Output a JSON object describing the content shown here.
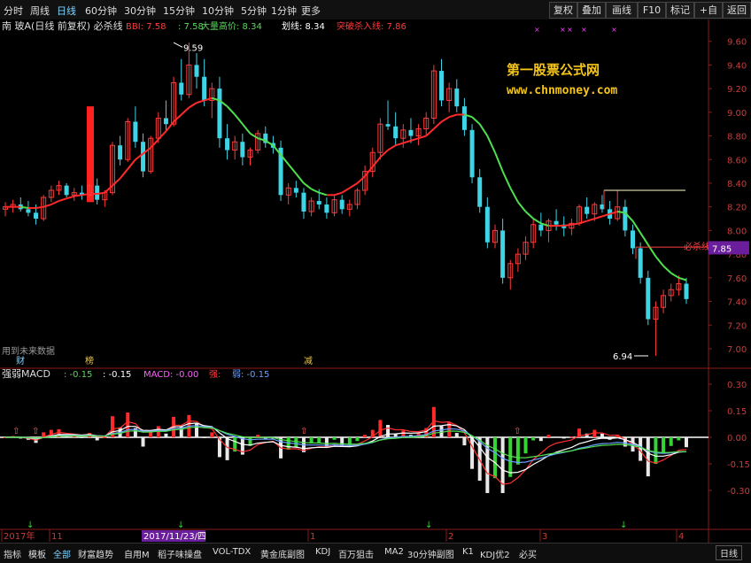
{
  "toolbar": {
    "left": [
      "分时",
      "周线",
      "日线",
      "60分钟",
      "30分钟",
      "15分钟",
      "10分钟",
      "5分钟",
      "1分钟",
      "更多"
    ],
    "right": [
      "复权",
      "叠加",
      "画线",
      "F10",
      "标记",
      "+自选",
      "返回"
    ]
  },
  "main": {
    "title": "南 玻A(日线 前复权) 必杀线",
    "legend": [
      {
        "label": "BBI: 7.58",
        "color": "#ff3b3b"
      },
      {
        "label": ": 7.58",
        "color": "#5cd65c"
      },
      {
        "label": "大量高价: 8.34",
        "color": "#5cd65c"
      },
      {
        "label": "划线: 8.34",
        "color": "#ffffff"
      },
      {
        "label": "突破杀入线: 7.86",
        "color": "#ff3b3b"
      }
    ],
    "watermark1": "第一股票公式网",
    "watermark2": "www.chnmoney.com",
    "yticks": [
      "9.60",
      "9.40",
      "9.20",
      "9.00",
      "8.80",
      "8.60",
      "8.40",
      "8.20",
      "8.00",
      "7.80",
      "7.60",
      "7.40",
      "7.20",
      "7.00"
    ],
    "current_price": "7.85",
    "high_label": "9.59",
    "low_label": "6.94",
    "kill_label": "必杀线",
    "future_note": "用到未来数据",
    "markers": [
      {
        "text": "财",
        "color": "#7fd4ff"
      },
      {
        "text": "榜",
        "color": "#e6c34a"
      },
      {
        "text": "减",
        "color": "#e6c34a"
      }
    ]
  },
  "sub": {
    "title": "强弱MACD",
    "legend": [
      {
        "label": ": -0.15",
        "color": "#5cd65c"
      },
      {
        "label": ": -0.15",
        "color": "#ffffff"
      },
      {
        "label": "MACD: -0.00",
        "color": "#ff60ff"
      },
      {
        "label": "强:",
        "color": "#ff3b3b"
      },
      {
        "label": "弱: -0.15",
        "color": "#6aa0ff"
      }
    ],
    "yticks": [
      "0.30",
      "0.15",
      "0.00",
      "-0.15",
      "-0.30"
    ]
  },
  "xaxis": {
    "labels": [
      "2017年",
      "11",
      "2017/11/23/四",
      "1",
      "2",
      "3",
      "4"
    ]
  },
  "bottom_tabs": [
    "指标",
    "模板",
    "全部",
    "财富趋势",
    "自用M",
    "稻子味操盘",
    "VOL-TDX",
    "黄金底副图",
    "KDJ",
    "百万狙击",
    "MA2",
    "30分钟副图",
    "K1",
    "KDJ优2",
    "必买"
  ],
  "bottom_right": "日线",
  "chart_data": {
    "type": "candlestick",
    "title": "南 玻A(日线 前复权) 必杀线",
    "ylim": [
      6.85,
      9.65
    ],
    "ohlc": [
      [
        8.18,
        8.24,
        8.12,
        8.2
      ],
      [
        8.2,
        8.26,
        8.15,
        8.22
      ],
      [
        8.22,
        8.28,
        8.16,
        8.18
      ],
      [
        8.18,
        8.25,
        8.12,
        8.15
      ],
      [
        8.15,
        8.22,
        8.05,
        8.1
      ],
      [
        8.1,
        8.3,
        8.08,
        8.28
      ],
      [
        8.28,
        8.38,
        8.24,
        8.34
      ],
      [
        8.34,
        8.42,
        8.3,
        8.38
      ],
      [
        8.38,
        8.4,
        8.28,
        8.3
      ],
      [
        8.3,
        8.36,
        8.25,
        8.32
      ],
      [
        8.32,
        8.38,
        8.26,
        8.3
      ],
      [
        8.3,
        8.4,
        8.28,
        8.38
      ],
      [
        8.38,
        8.44,
        8.22,
        8.26
      ],
      [
        8.26,
        8.34,
        8.2,
        8.32
      ],
      [
        8.32,
        8.75,
        8.3,
        8.72
      ],
      [
        8.72,
        8.8,
        8.55,
        8.6
      ],
      [
        8.6,
        8.95,
        8.58,
        8.92
      ],
      [
        8.92,
        9.05,
        8.7,
        8.75
      ],
      [
        8.75,
        8.82,
        8.45,
        8.5
      ],
      [
        8.5,
        8.8,
        8.48,
        8.78
      ],
      [
        8.78,
        9.0,
        8.74,
        8.95
      ],
      [
        8.95,
        9.1,
        8.85,
        8.9
      ],
      [
        8.9,
        9.3,
        8.88,
        9.25
      ],
      [
        9.25,
        9.45,
        9.1,
        9.15
      ],
      [
        9.15,
        9.59,
        9.12,
        9.4
      ],
      [
        9.4,
        9.5,
        9.2,
        9.3
      ],
      [
        9.3,
        9.45,
        9.05,
        9.1
      ],
      [
        9.1,
        9.25,
        8.95,
        9.2
      ],
      [
        9.2,
        9.3,
        8.7,
        8.78
      ],
      [
        8.78,
        8.9,
        8.6,
        8.68
      ],
      [
        8.68,
        8.8,
        8.6,
        8.75
      ],
      [
        8.75,
        8.82,
        8.55,
        8.62
      ],
      [
        8.62,
        8.7,
        8.55,
        8.68
      ],
      [
        8.68,
        8.85,
        8.65,
        8.82
      ],
      [
        8.82,
        8.88,
        8.7,
        8.74
      ],
      [
        8.74,
        8.8,
        8.65,
        8.7
      ],
      [
        8.7,
        8.76,
        8.25,
        8.3
      ],
      [
        8.3,
        8.4,
        8.22,
        8.36
      ],
      [
        8.36,
        8.42,
        8.28,
        8.32
      ],
      [
        8.32,
        8.36,
        8.1,
        8.16
      ],
      [
        8.16,
        8.28,
        8.12,
        8.25
      ],
      [
        8.25,
        8.35,
        8.18,
        8.22
      ],
      [
        8.22,
        8.28,
        8.1,
        8.15
      ],
      [
        8.15,
        8.3,
        8.12,
        8.26
      ],
      [
        8.26,
        8.3,
        8.14,
        8.18
      ],
      [
        8.18,
        8.26,
        8.12,
        8.22
      ],
      [
        8.22,
        8.36,
        8.18,
        8.34
      ],
      [
        8.34,
        8.55,
        8.3,
        8.5
      ],
      [
        8.5,
        8.7,
        8.45,
        8.66
      ],
      [
        8.66,
        8.95,
        8.6,
        8.9
      ],
      [
        8.9,
        9.1,
        8.85,
        8.88
      ],
      [
        8.88,
        9.0,
        8.72,
        8.78
      ],
      [
        8.78,
        8.9,
        8.7,
        8.85
      ],
      [
        8.85,
        8.95,
        8.74,
        8.8
      ],
      [
        8.8,
        8.9,
        8.72,
        8.86
      ],
      [
        8.86,
        9.0,
        8.8,
        8.95
      ],
      [
        8.95,
        9.4,
        8.9,
        9.35
      ],
      [
        9.35,
        9.45,
        9.05,
        9.1
      ],
      [
        9.1,
        9.25,
        9.0,
        9.2
      ],
      [
        9.2,
        9.28,
        9.0,
        9.05
      ],
      [
        9.05,
        9.12,
        8.8,
        8.85
      ],
      [
        8.85,
        8.9,
        8.4,
        8.45
      ],
      [
        8.45,
        8.52,
        8.15,
        8.2
      ],
      [
        8.2,
        8.28,
        7.85,
        7.9
      ],
      [
        7.9,
        8.05,
        7.85,
        8.0
      ],
      [
        8.0,
        8.1,
        7.55,
        7.6
      ],
      [
        7.6,
        7.75,
        7.5,
        7.72
      ],
      [
        7.72,
        7.85,
        7.65,
        7.8
      ],
      [
        7.8,
        7.95,
        7.75,
        7.9
      ],
      [
        7.9,
        8.1,
        7.85,
        8.05
      ],
      [
        8.05,
        8.15,
        7.95,
        8.0
      ],
      [
        8.0,
        8.1,
        7.9,
        8.08
      ],
      [
        8.08,
        8.18,
        8.0,
        8.05
      ],
      [
        8.05,
        8.12,
        7.95,
        8.02
      ],
      [
        8.02,
        8.1,
        7.96,
        8.06
      ],
      [
        8.06,
        8.22,
        8.04,
        8.2
      ],
      [
        8.2,
        8.28,
        8.1,
        8.14
      ],
      [
        8.14,
        8.24,
        8.08,
        8.22
      ],
      [
        8.22,
        8.3,
        8.15,
        8.18
      ],
      [
        8.18,
        8.25,
        8.05,
        8.1
      ],
      [
        8.1,
        8.34,
        8.08,
        8.2
      ],
      [
        8.2,
        8.26,
        7.95,
        8.0
      ],
      [
        8.0,
        8.05,
        7.8,
        7.85
      ],
      [
        7.85,
        7.9,
        7.55,
        7.6
      ],
      [
        7.6,
        7.66,
        7.2,
        7.25
      ],
      [
        7.25,
        7.4,
        6.94,
        7.35
      ],
      [
        7.35,
        7.5,
        7.3,
        7.45
      ],
      [
        7.45,
        7.55,
        7.4,
        7.5
      ],
      [
        7.5,
        7.62,
        7.45,
        7.55
      ],
      [
        7.55,
        7.6,
        7.38,
        7.42
      ]
    ],
    "series": [
      {
        "name": "BBI",
        "values": [
          8.2,
          8.2,
          8.2,
          8.19,
          8.19,
          8.2,
          8.22,
          8.25,
          8.27,
          8.29,
          8.3,
          8.31,
          8.31,
          8.32,
          8.38,
          8.44,
          8.52,
          8.6,
          8.65,
          8.7,
          8.77,
          8.84,
          8.92,
          8.98,
          9.04,
          9.08,
          9.1,
          9.12,
          9.1,
          9.05,
          8.98,
          8.9,
          8.82,
          8.78,
          8.76,
          8.72,
          8.64,
          8.56,
          8.48,
          8.4,
          8.35,
          8.32,
          8.3,
          8.3,
          8.32,
          8.36,
          8.4,
          8.46,
          8.54,
          8.62,
          8.68,
          8.72,
          8.74,
          8.76,
          8.78,
          8.8,
          8.86,
          8.92,
          8.96,
          8.98,
          8.98,
          8.96,
          8.9,
          8.8,
          8.66,
          8.5,
          8.36,
          8.24,
          8.16,
          8.1,
          8.06,
          8.04,
          8.04,
          8.04,
          8.05,
          8.06,
          8.08,
          8.1,
          8.12,
          8.14,
          8.16,
          8.15,
          8.08,
          7.98,
          7.88,
          7.78,
          7.7,
          7.64,
          7.6,
          7.58
        ]
      }
    ]
  }
}
